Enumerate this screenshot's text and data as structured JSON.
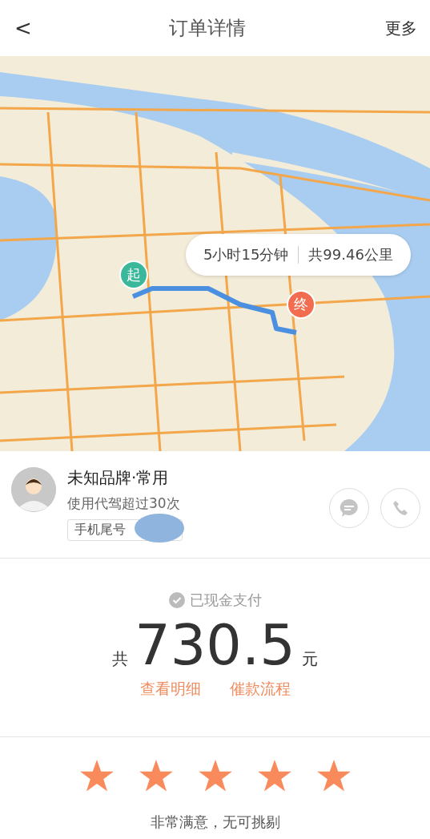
{
  "header": {
    "back": "<",
    "title": "订单详情",
    "more": "更多"
  },
  "map": {
    "start_label": "起",
    "end_label": "终",
    "duration": "5小时15分钟",
    "distance": "共99.46公里"
  },
  "driver": {
    "name": "未知品牌·常用",
    "usage": "使用代驾超过30次",
    "phone_tag": "手机尾号"
  },
  "payment": {
    "status": "已现金支付",
    "prefix": "共",
    "amount": "730.5",
    "unit": "元",
    "links": [
      "查看明细",
      "催款流程"
    ]
  },
  "rating": {
    "stars": 5,
    "comment": "非常满意，无可挑剔"
  }
}
